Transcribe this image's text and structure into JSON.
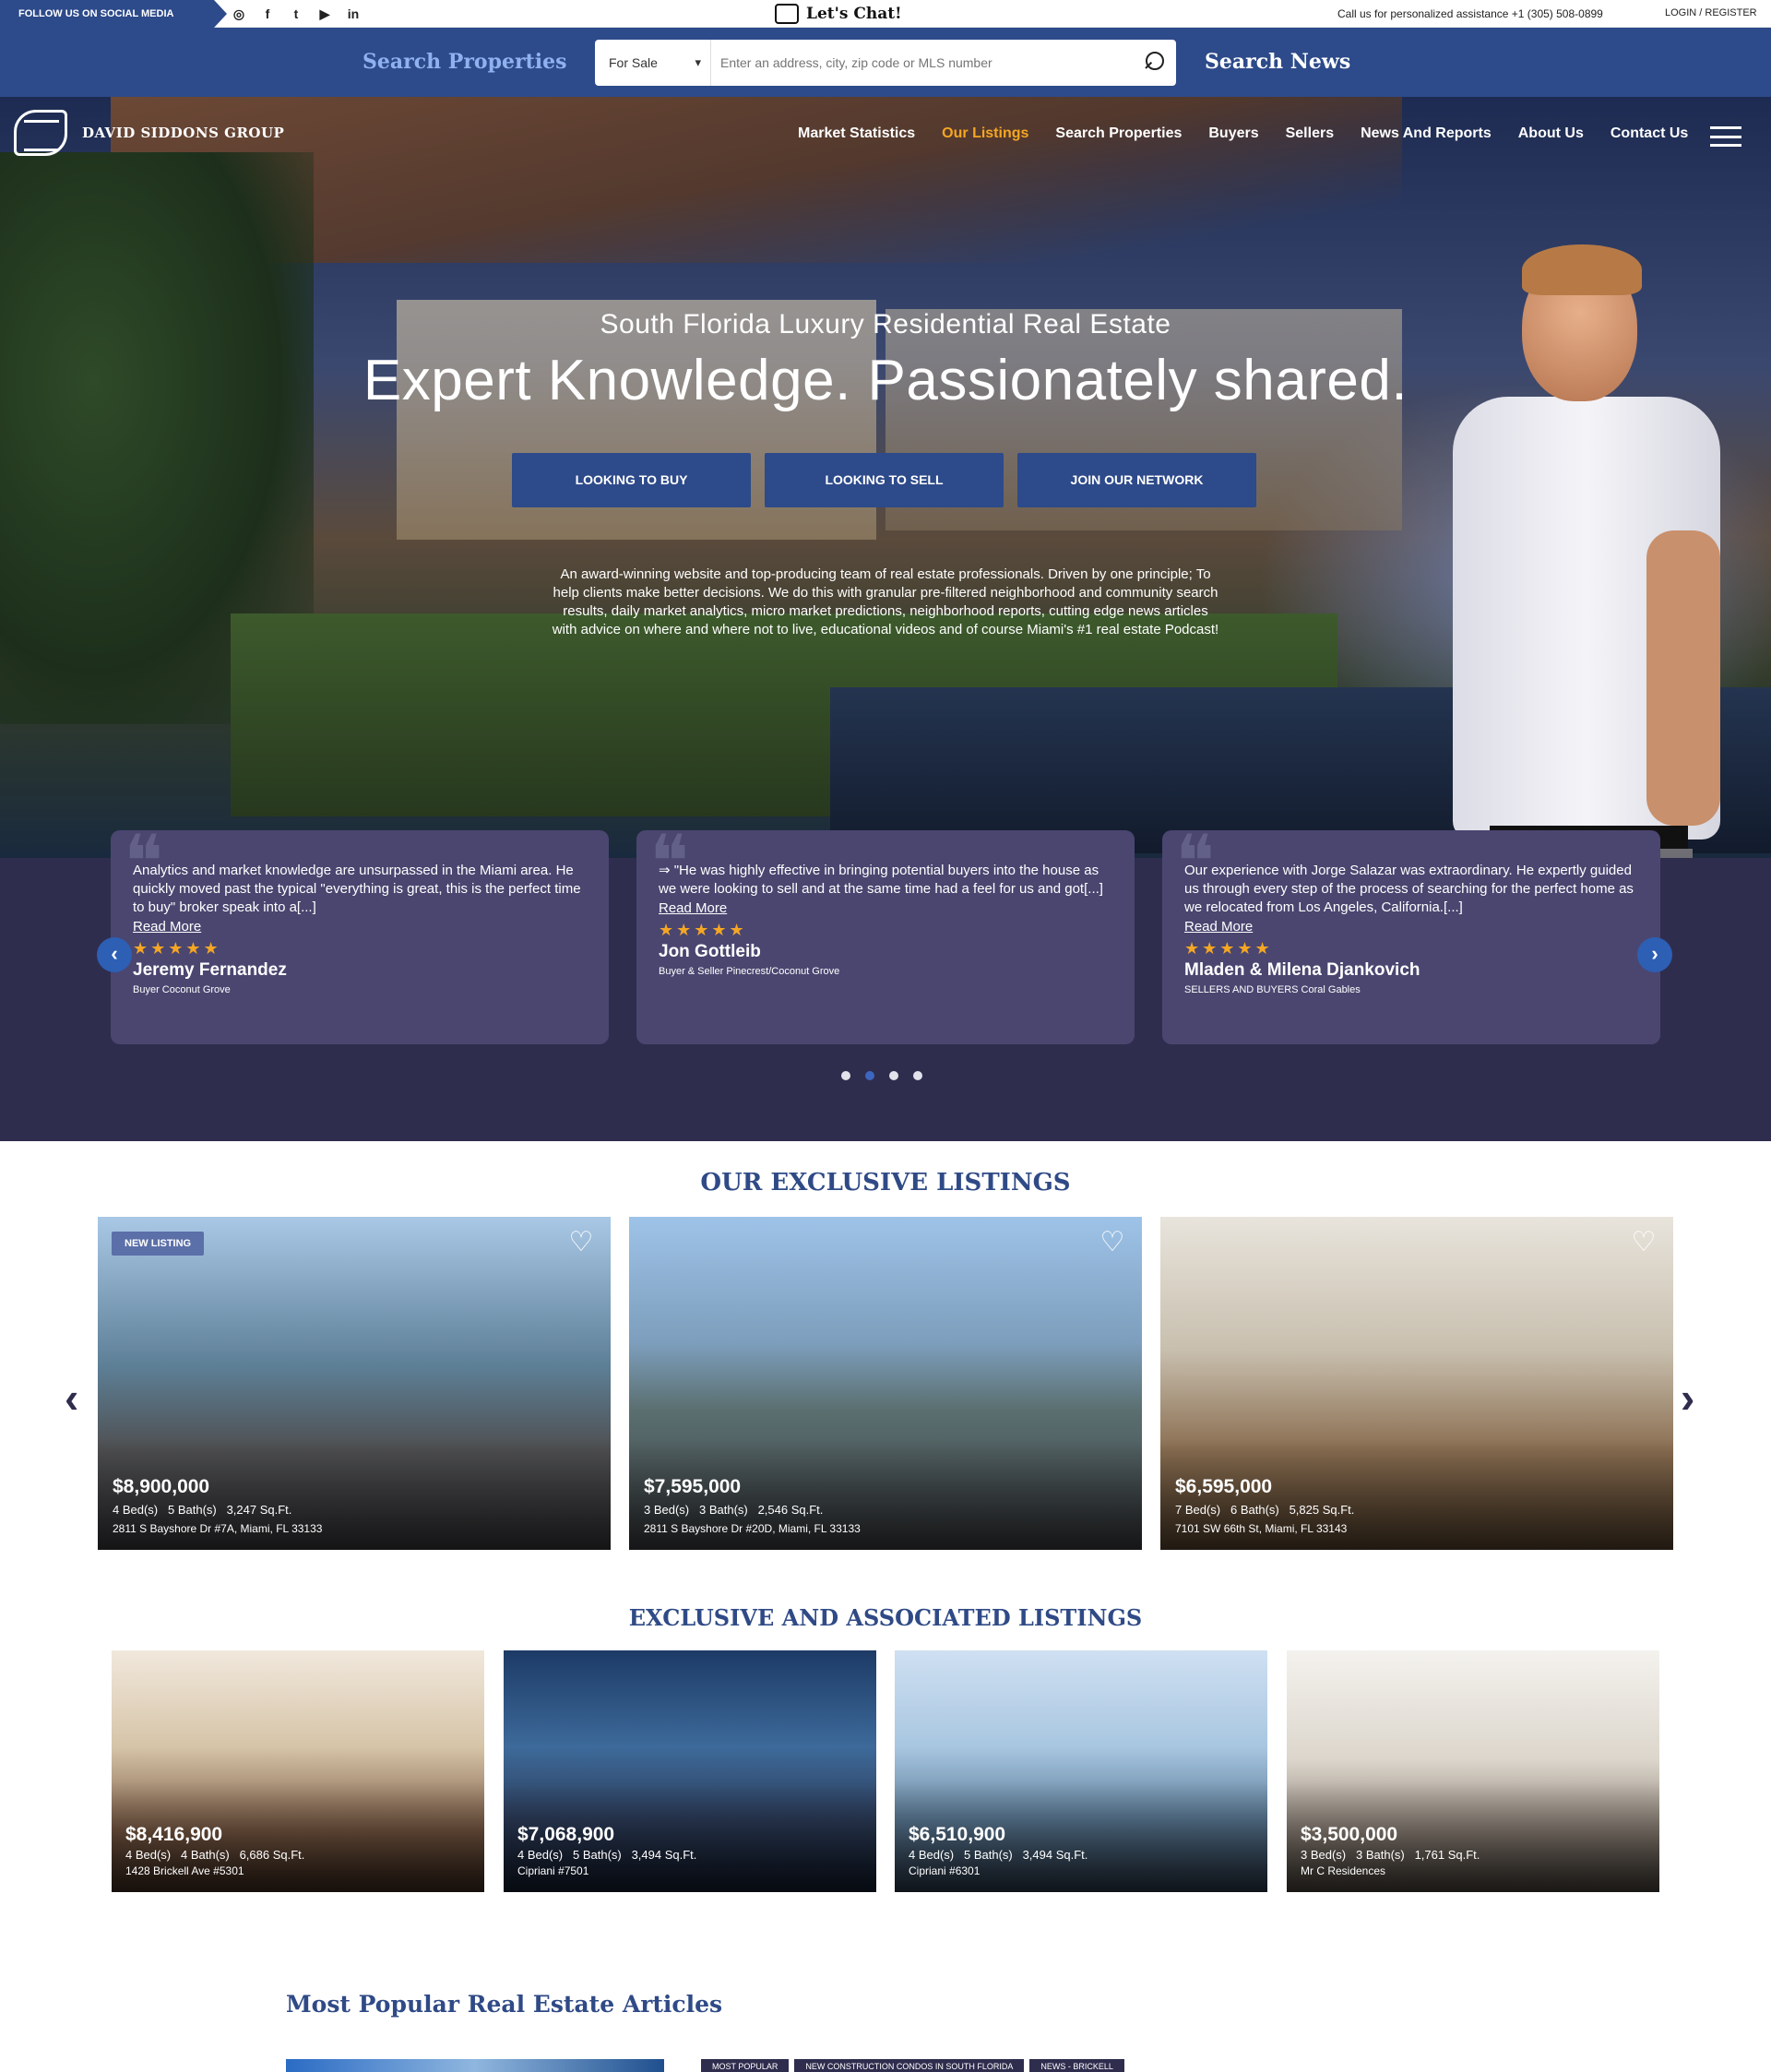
{
  "topbar": {
    "follow_label": "FOLLOW US ON SOCIAL MEDIA",
    "social_icons": [
      "instagram-icon",
      "facebook-icon",
      "twitter-icon",
      "youtube-icon",
      "linkedin-icon"
    ],
    "social_glyphs": [
      "◎",
      "f",
      "t",
      "▶",
      "in"
    ],
    "chat_label": "Let's Chat!",
    "call_text": "Call us for personalized assistance +1 (305) 508-0899",
    "login_text": "LOGIN / REGISTER"
  },
  "search": {
    "properties_label": "Search Properties",
    "news_label": "Search News",
    "type_selected": "For Sale",
    "placeholder": "Enter an address, city, zip code or MLS number"
  },
  "nav": {
    "logo_text": "DAVID SIDDONS GROUP",
    "items": [
      {
        "label": "Market Statistics",
        "active": false
      },
      {
        "label": "Our Listings",
        "active": true
      },
      {
        "label": "Search Properties",
        "active": false
      },
      {
        "label": "Buyers",
        "active": false
      },
      {
        "label": "Sellers",
        "active": false
      },
      {
        "label": "News And Reports",
        "active": false
      },
      {
        "label": "About Us",
        "active": false
      },
      {
        "label": "Contact Us",
        "active": false
      }
    ],
    "active_color": "#f5a623"
  },
  "hero": {
    "subtitle": "South Florida Luxury Residential Real Estate",
    "title": "Expert Knowledge. Passionately shared.",
    "buttons": [
      "LOOKING TO BUY",
      "LOOKING TO SELL",
      "JOIN OUR NETWORK"
    ],
    "description": "An award-winning website and top-producing team of real estate professionals. Driven by one principle; To help clients make better decisions. We do this with granular pre-filtered neighborhood and community search results, daily market analytics, micro market predictions, neighborhood reports, cutting edge news articles with advice on where and where not to live, educational videos and of course Miami's #1 real estate Podcast!"
  },
  "testimonials": {
    "read_more": "Read More",
    "stars": "★★★★★",
    "cards": [
      {
        "text": "Analytics and market knowledge are unsurpassed in the Miami area. He quickly moved past the typical \"everything is great, this is the perfect time to buy\" broker speak into a[...]",
        "name": "Jeremy Fernandez",
        "role": "Buyer Coconut Grove"
      },
      {
        "text": "⇒ \"He was highly effective in bringing potential buyers into the house as we were looking to sell and at the same time had a feel for us and got[...]",
        "name": "Jon Gottleib",
        "role": "Buyer & Seller Pinecrest/Coconut Grove"
      },
      {
        "text": "Our experience with Jorge Salazar was extraordinary. He expertly guided us through every step of the process of searching for the perfect home as we relocated from Los Angeles, California.[...]",
        "name": "Mladen & Milena Djankovich",
        "role": "SELLERS AND BUYERS Coral Gables"
      }
    ],
    "active_dot": 1,
    "dot_count": 4
  },
  "exclusive": {
    "title": "OUR EXCLUSIVE LISTINGS",
    "badge": "NEW LISTING",
    "listings": [
      {
        "price": "$8,900,000",
        "beds": "4 Bed(s)",
        "baths": "5 Bath(s)",
        "sqft": "3,247 Sq.Ft.",
        "address": "2811 S Bayshore Dr #7A, Miami, FL 33133"
      },
      {
        "price": "$7,595,000",
        "beds": "3 Bed(s)",
        "baths": "3 Bath(s)",
        "sqft": "2,546 Sq.Ft.",
        "address": "2811 S Bayshore Dr #20D, Miami, FL 33133"
      },
      {
        "price": "$6,595,000",
        "beds": "7 Bed(s)",
        "baths": "6 Bath(s)",
        "sqft": "5,825 Sq.Ft.",
        "address": "7101 SW 66th St, Miami, FL 33143"
      }
    ]
  },
  "associated": {
    "title": "EXCLUSIVE AND ASSOCIATED LISTINGS",
    "listings": [
      {
        "price": "$8,416,900",
        "beds": "4 Bed(s)",
        "baths": "4 Bath(s)",
        "sqft": "6,686 Sq.Ft.",
        "address": "1428 Brickell Ave #5301"
      },
      {
        "price": "$7,068,900",
        "beds": "4 Bed(s)",
        "baths": "5 Bath(s)",
        "sqft": "3,494 Sq.Ft.",
        "address": "Cipriani #7501"
      },
      {
        "price": "$6,510,900",
        "beds": "4 Bed(s)",
        "baths": "5 Bath(s)",
        "sqft": "3,494 Sq.Ft.",
        "address": "Cipriani #6301"
      },
      {
        "price": "$3,500,000",
        "beds": "3 Bed(s)",
        "baths": "3 Bath(s)",
        "sqft": "1,761 Sq.Ft.",
        "address": "Mr C Residences"
      }
    ]
  },
  "articles": {
    "title": "Most Popular Real Estate Articles",
    "tags": [
      "MOST POPULAR",
      "NEW CONSTRUCTION CONDOS IN SOUTH FLORIDA",
      "NEWS - BRICKELL"
    ]
  }
}
